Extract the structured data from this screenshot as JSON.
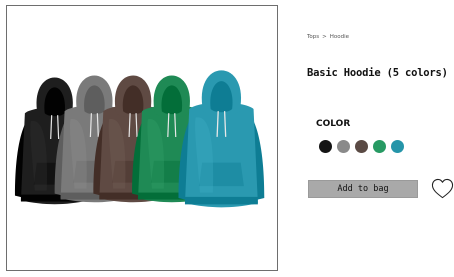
{
  "breadcrumb": {
    "parent": "Tops",
    "separator": ">",
    "current": "Hoodie"
  },
  "product": {
    "title": "Basic Hoodie (5 colors)"
  },
  "color": {
    "label": "COLOR",
    "swatches": [
      {
        "name": "black",
        "hex": "#141414"
      },
      {
        "name": "gray",
        "hex": "#8a8a8a"
      },
      {
        "name": "brown",
        "hex": "#5a4a44"
      },
      {
        "name": "green",
        "hex": "#279a63"
      },
      {
        "name": "teal",
        "hex": "#2595a9"
      }
    ]
  },
  "actions": {
    "add_to_bag_label": "Add to bag",
    "wishlist_icon": "heart-icon"
  },
  "image": {
    "hoodie_colors": [
      {
        "name": "black",
        "hex": "#1e1e1e"
      },
      {
        "name": "gray",
        "hex": "#7a7a7a"
      },
      {
        "name": "brown",
        "hex": "#5f4a43"
      },
      {
        "name": "green",
        "hex": "#1f8a55"
      },
      {
        "name": "teal",
        "hex": "#2a99b0"
      }
    ]
  }
}
